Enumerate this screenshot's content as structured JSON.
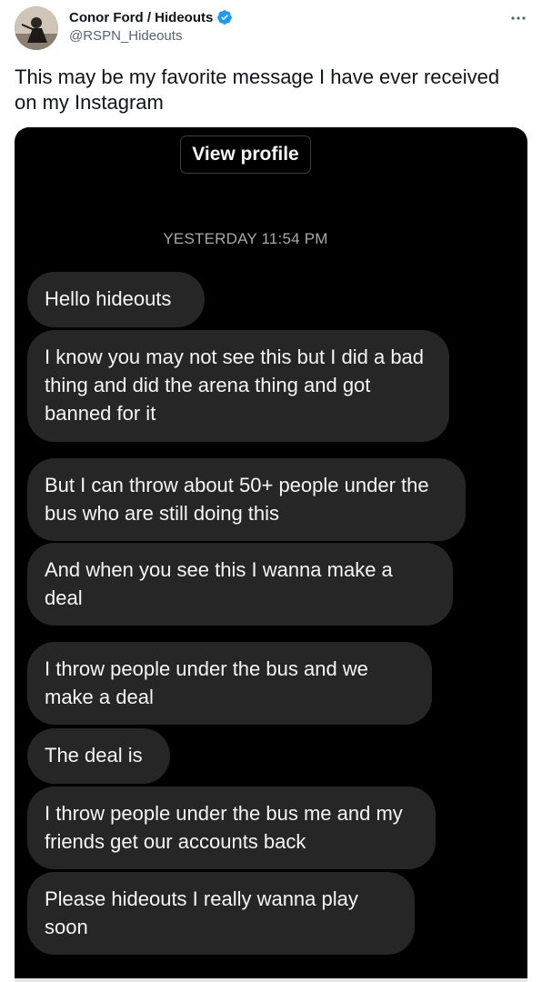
{
  "author": {
    "display_name": "Conor Ford / Hideouts",
    "handle": "@RSPN_Hideouts",
    "verified": true
  },
  "tweet": {
    "text": "This may be my favorite message I have ever received on my Instagram"
  },
  "icons": {
    "verified": "verified-badge-icon",
    "more": "more-horizontal-icon"
  },
  "colors": {
    "verified_blue": "#1d9bf0",
    "bubble": "#262626",
    "screenshot_bg": "#000000",
    "timestamp_gray": "#a8a8a8"
  },
  "screenshot": {
    "view_profile_label": "View profile",
    "timestamp": "YESTERDAY 11:54 PM",
    "messages": [
      "Hello hideouts",
      "I know you may not see this but I did a bad thing and did the arena thing and got banned for it",
      "But I can throw about 50+ people under the bus who are still doing this",
      "And when you see this I wanna make a deal",
      "I throw people under the bus and we make a deal",
      "The deal is",
      "I throw people under the bus me and my friends get our accounts back",
      "Please hideouts I really wanna play soon"
    ]
  }
}
